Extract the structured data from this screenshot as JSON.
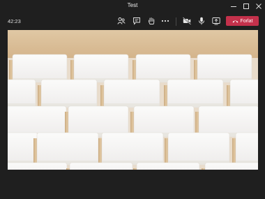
{
  "window": {
    "title": "Test",
    "controls": [
      "minimize-icon",
      "maximize-icon",
      "close-icon"
    ]
  },
  "toolbar": {
    "timer": "42:23",
    "buttons": [
      {
        "icon": "people-icon"
      },
      {
        "icon": "chat-icon"
      },
      {
        "icon": "raise-hand-icon"
      },
      {
        "icon": "more-options-icon"
      },
      {
        "icon": "camera-icon"
      },
      {
        "icon": "microphone-icon"
      },
      {
        "icon": "share-screen-icon"
      }
    ],
    "leave_label": "Forlat",
    "leave_color": "#c4314b"
  },
  "stage": {
    "content": "background-image",
    "palette": {
      "wall": "#e9dccb",
      "wood": "#d4b48b",
      "seat": "#f5f5f5"
    }
  }
}
